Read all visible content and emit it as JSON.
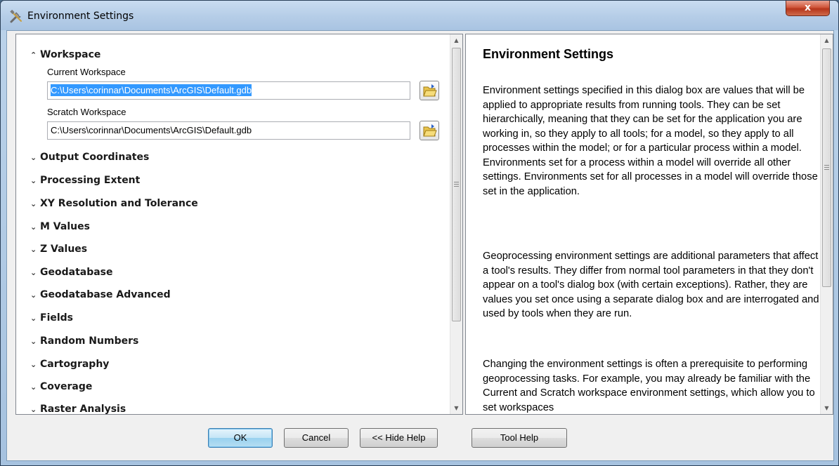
{
  "window": {
    "title": "Environment Settings",
    "close_label": "x"
  },
  "workspace": {
    "header": "Workspace",
    "current_label": "Current Workspace",
    "current_value": "C:\\Users\\corinnar\\Documents\\ArcGIS\\Default.gdb",
    "scratch_label": "Scratch Workspace",
    "scratch_value": "C:\\Users\\corinnar\\Documents\\ArcGIS\\Default.gdb"
  },
  "sections": [
    "Output Coordinates",
    "Processing Extent",
    "XY Resolution and Tolerance",
    "M Values",
    "Z Values",
    "Geodatabase",
    "Geodatabase Advanced",
    "Fields",
    "Random Numbers",
    "Cartography",
    "Coverage",
    "Raster Analysis"
  ],
  "help": {
    "title": "Environment Settings",
    "p1": "Environment settings specified in this dialog box are values that will be applied to appropriate results from running tools. They can be set hierarchically, meaning that they can be set for the application you are working in, so they apply to all tools; for a model, so they apply to all processes within the model; or for a particular process within a model. Environments set for a process within a model will override all other settings. Environments set for all processes in a model will override those set in the application.",
    "p2": "Geoprocessing environment settings are additional parameters that affect a tool's results. They differ from normal tool parameters in that they don't appear on a tool's dialog box (with certain exceptions). Rather, they are values you set once using a separate dialog box and are interrogated and used by tools when they are run.",
    "p3": "Changing the environment settings is often a prerequisite to performing geoprocessing tasks. For example, you may already be familiar with the Current and Scratch workspace environment settings, which allow you to set workspaces"
  },
  "buttons": {
    "ok": "OK",
    "cancel": "Cancel",
    "hide_help": "<< Hide Help",
    "tool_help": "Tool Help"
  }
}
